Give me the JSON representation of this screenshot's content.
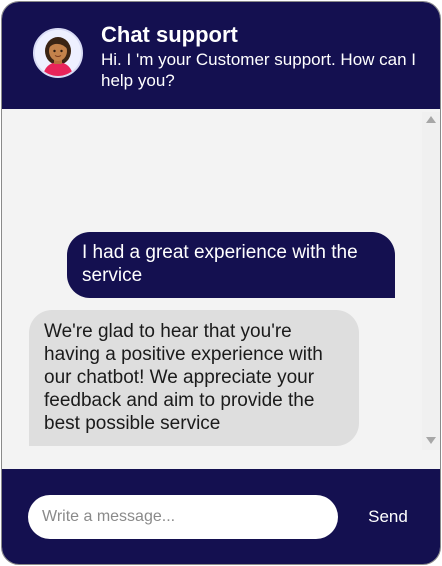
{
  "header": {
    "title": "Chat support",
    "subtitle": "Hi. I 'm your Customer support. How can I help you?"
  },
  "messages": [
    {
      "sender": "user",
      "text": "I had a great experience with the service"
    },
    {
      "sender": "bot",
      "text": "We're glad to hear that you're having a positive experience with our chatbot! We appreciate your feedback and aim to provide the best possible service"
    }
  ],
  "composer": {
    "placeholder": "Write a message...",
    "value": "",
    "send_label": "Send"
  },
  "icons": {
    "avatar": "support-agent-avatar",
    "scroll_up": "scroll-up-arrow",
    "scroll_down": "scroll-down-arrow"
  },
  "colors": {
    "primary": "#141050",
    "bot_bubble": "#dedede",
    "background": "#f3f3f3"
  }
}
